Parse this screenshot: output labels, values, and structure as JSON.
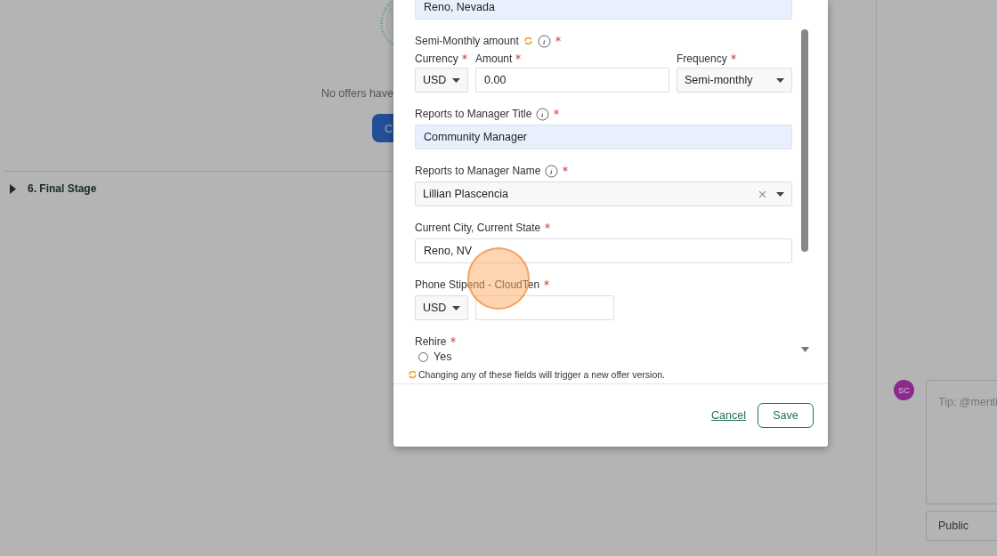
{
  "page": {
    "empty_message": "No offers have",
    "create_button": "C",
    "sections": [
      {
        "label": "6. Final Stage",
        "expanded": false
      }
    ]
  },
  "comments": {
    "avatar": "SC",
    "placeholder": "Tip: @menti",
    "visibility": "Public"
  },
  "modal": {
    "fields": [
      {
        "kind": "text",
        "value": "Reno, Nevada",
        "autofilled": true
      },
      {
        "kind": "row",
        "label": "Semi-Monthly amount",
        "versioned": true,
        "info": true,
        "required": true,
        "inputs": [
          {
            "kind": "select",
            "label": "Currency",
            "required": true,
            "value": "USD"
          },
          {
            "kind": "text",
            "label": "Amount",
            "required": true,
            "value": "0.00"
          },
          {
            "kind": "select",
            "label": "Frequency",
            "required": true,
            "value": "Semi-monthly"
          }
        ]
      },
      {
        "kind": "text",
        "label": "Reports to Manager Title",
        "info": true,
        "required": true,
        "value": "Community Manager",
        "autofilled": true
      },
      {
        "kind": "combo",
        "label": "Reports to Manager Name",
        "info": true,
        "required": true,
        "value": "Lillian Plascencia",
        "clearable": true
      },
      {
        "kind": "text",
        "label": "Current City, Current State",
        "required": true,
        "value": "Reno, NV",
        "autofilled": false
      },
      {
        "kind": "row",
        "label": "Phone Stipend - CloudTen",
        "required": true,
        "inputs": [
          {
            "kind": "select",
            "value": "USD"
          },
          {
            "kind": "text"
          }
        ]
      },
      {
        "kind": "radio",
        "label": "Rehire",
        "required": true,
        "options": [
          {
            "label": "Yes",
            "selected": false
          }
        ]
      }
    ],
    "note": "Changing any of these fields will trigger a new offer version.",
    "cancel": "Cancel",
    "save": "Save"
  }
}
